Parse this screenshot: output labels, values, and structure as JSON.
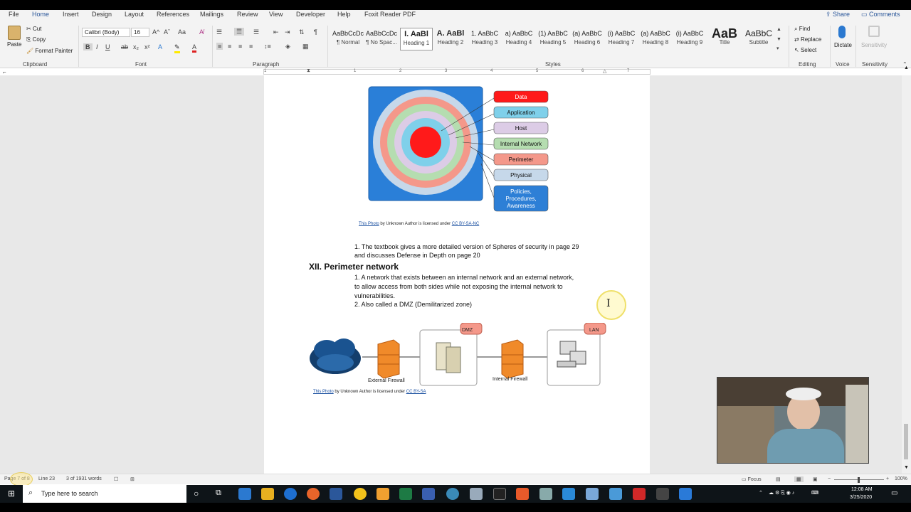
{
  "titlebar": {},
  "tabs": [
    "File",
    "Home",
    "Insert",
    "Design",
    "Layout",
    "References",
    "Mailings",
    "Review",
    "View",
    "Developer",
    "Help",
    "Foxit Reader PDF"
  ],
  "share_label": "Share",
  "comments_label": "Comments",
  "ribbon": {
    "clipboard": {
      "paste": "Paste",
      "cut": "Cut",
      "copy": "Copy",
      "format_painter": "Format Painter",
      "group": "Clipboard"
    },
    "font": {
      "name": "Calibri (Body)",
      "size": "16",
      "group": "Font"
    },
    "paragraph": {
      "group": "Paragraph"
    },
    "styles": {
      "group": "Styles",
      "items": [
        {
          "preview": "AaBbCcDc",
          "name": "¶ Normal"
        },
        {
          "preview": "AaBbCcDc",
          "name": "¶ No Spac..."
        },
        {
          "preview": "I. AaBl",
          "name": "Heading 1"
        },
        {
          "preview": "A. AaBl",
          "name": "Heading 2"
        },
        {
          "preview": "1. AaBbC",
          "name": "Heading 3"
        },
        {
          "preview": "a) AaBbC",
          "name": "Heading 4"
        },
        {
          "preview": "(1) AaBbC",
          "name": "Heading 5"
        },
        {
          "preview": "(a) AaBbC",
          "name": "Heading 6"
        },
        {
          "preview": "(i) AaBbC",
          "name": "Heading 7"
        },
        {
          "preview": "(a) AaBbC",
          "name": "Heading 8"
        },
        {
          "preview": "(i) AaBbC",
          "name": "Heading 9"
        },
        {
          "preview": "AaB",
          "name": "Title"
        },
        {
          "preview": "AaBbC",
          "name": "Subtitle"
        }
      ]
    },
    "editing": {
      "find": "Find",
      "replace": "Replace",
      "select": "Select",
      "group": "Editing"
    },
    "voice": {
      "dictate": "Dictate",
      "group": "Voice"
    },
    "sensitivity": {
      "label": "Sensitivity",
      "group": "Sensitivity"
    }
  },
  "ruler": {
    "marks": [
      "1",
      "1",
      "2",
      "3",
      "4",
      "5",
      "6",
      "7"
    ]
  },
  "document": {
    "spheres": {
      "labels": [
        "Data",
        "Application",
        "Host",
        "Internal Network",
        "Perimeter",
        "Physical",
        "Policies, Procedures, Awareness"
      ],
      "colors": [
        "#ff1a1a",
        "#7fd0ea",
        "#dccce6",
        "#b5ddb0",
        "#f4988a",
        "#c6d8ea",
        "#2d7fd6"
      ]
    },
    "attribution1": {
      "link1": "This Photo",
      "mid": " by Unknown Author is licensed under ",
      "link2": "CC BY-SA-NC"
    },
    "list1": "1. The textbook gives a more detailed version of Spheres of security in page 29",
    "list1b": "and discusses Defense in Depth on page 20",
    "heading": "XII. Perimeter network",
    "p1a": "1. A network that exists between an internal network and an external network,",
    "p1b": "to allow access from both sides while not exposing the internal network to",
    "p1c": "vulnerabilities.",
    "p2": "2. Also called a DMZ (Demilitarized zone)",
    "diagram": {
      "dmz": "DMZ",
      "lan": "LAN",
      "ext": "External Firewall",
      "int": "Internal Firewall"
    },
    "attribution2": {
      "link1": "This Photo",
      "mid": " by Unknown Author is licensed under ",
      "link2": "CC BY-SA"
    }
  },
  "status": {
    "page": "Page 7 of 8",
    "line": "Line 23",
    "words": "3 of 1931 words",
    "focus": "Focus",
    "zoom": "100%"
  },
  "taskbar": {
    "search": "Type here to search",
    "time": "12:08 AM",
    "date": "3/25/2020"
  }
}
